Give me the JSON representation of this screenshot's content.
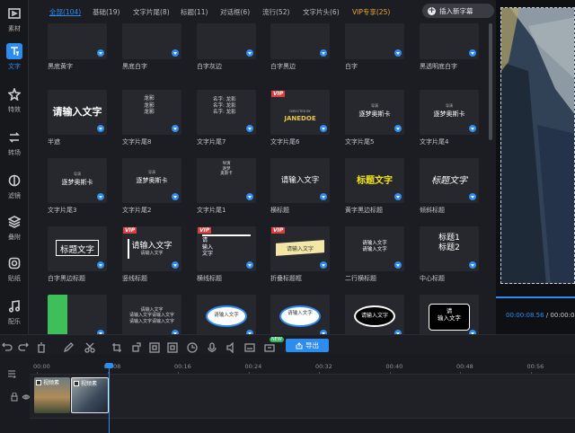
{
  "sidebar": {
    "items": [
      {
        "label": "素材",
        "icon": "media-icon"
      },
      {
        "label": "文字",
        "icon": "text-icon"
      },
      {
        "label": "特效",
        "icon": "effects-icon"
      },
      {
        "label": "转场",
        "icon": "transition-icon"
      },
      {
        "label": "滤镜",
        "icon": "filter-icon"
      },
      {
        "label": "叠附",
        "icon": "overlay-icon"
      },
      {
        "label": "贴纸",
        "icon": "sticker-icon"
      },
      {
        "label": "配乐",
        "icon": "music-icon"
      }
    ],
    "active_index": 1
  },
  "tabs": [
    {
      "label": "全部(104)",
      "active": true
    },
    {
      "label": "基础(19)"
    },
    {
      "label": "文字片尾(8)"
    },
    {
      "label": "标题(11)"
    },
    {
      "label": "对话框(6)"
    },
    {
      "label": "流行(52)"
    },
    {
      "label": "文字片头(6)"
    },
    {
      "label": "VIP专享(25)",
      "vip": true
    }
  ],
  "insert_button": "插入新字幕",
  "templates": [
    {
      "name": "黑底黄字"
    },
    {
      "name": "黑底白字"
    },
    {
      "name": "白字灰边"
    },
    {
      "name": "白字黑边"
    },
    {
      "name": "白字"
    },
    {
      "name": "黑透明底白字"
    },
    {
      "name": "半遮",
      "preview": "请输入文字"
    },
    {
      "name": "文字片尾8",
      "preview": "龙影\n龙影\n龙影"
    },
    {
      "name": "文字片尾7",
      "preview": "名字: 龙影\n名字: 龙影\n名字: 龙影"
    },
    {
      "name": "文字片尾6",
      "preview": "JANEDOE",
      "preview_sub": "DIRECTED BY",
      "vip": true
    },
    {
      "name": "文字片尾5",
      "preview": "逐梦奥斯卡",
      "preview_sub": "导演"
    },
    {
      "name": "文字片尾4",
      "preview": "逐梦奥斯卡",
      "preview_sub": "导演"
    },
    {
      "name": "文字片尾3",
      "preview": "逐梦奥斯卡",
      "preview_sub": "导演"
    },
    {
      "name": "文字片尾2",
      "preview": "逐梦奥斯卡",
      "preview_sub": "导演"
    },
    {
      "name": "文字片尾1",
      "preview": "导演\n逐梦\n奥斯卡"
    },
    {
      "name": "横标题",
      "preview": "请输入文字"
    },
    {
      "name": "黄字黑边标题",
      "preview": "标题文字"
    },
    {
      "name": "倾斜标题",
      "preview": "标题文字"
    },
    {
      "name": "白字黑边标题",
      "preview": "标题文字"
    },
    {
      "name": "竖线标题",
      "preview": "请输入文字",
      "preview_sub": "请输入文字",
      "vip": true
    },
    {
      "name": "横线标题",
      "preview": "请\n输入\n文字",
      "vip": true
    },
    {
      "name": "折叠标题框",
      "preview": "请输入文字",
      "vip": true
    },
    {
      "name": "二行横标题",
      "preview": "请输入文字\n请输入文字"
    },
    {
      "name": "中心标题",
      "preview": "标题1\n标题2"
    },
    {
      "name": ""
    },
    {
      "name": "",
      "preview": "请输入文字\n请输入文字请输入文字\n请输入文字请输入文字"
    },
    {
      "name": "",
      "preview": "请输入文字"
    },
    {
      "name": "",
      "preview": "请输入文字"
    },
    {
      "name": "",
      "preview": "请输入文字"
    },
    {
      "name": "",
      "preview": "请\n输入文字"
    }
  ],
  "preview": {
    "current_time": "00:00:08.56",
    "total_time": "00:00:08."
  },
  "toolbar": {
    "export_label": "导出",
    "new_badge": "NEW"
  },
  "timeline": {
    "ticks": [
      "00:00",
      "00:08",
      "00:16",
      "00:24",
      "00:32",
      "00:40",
      "00:48",
      "00:56"
    ],
    "clips": [
      {
        "label": "视频素"
      },
      {
        "label": "视频素"
      }
    ]
  }
}
